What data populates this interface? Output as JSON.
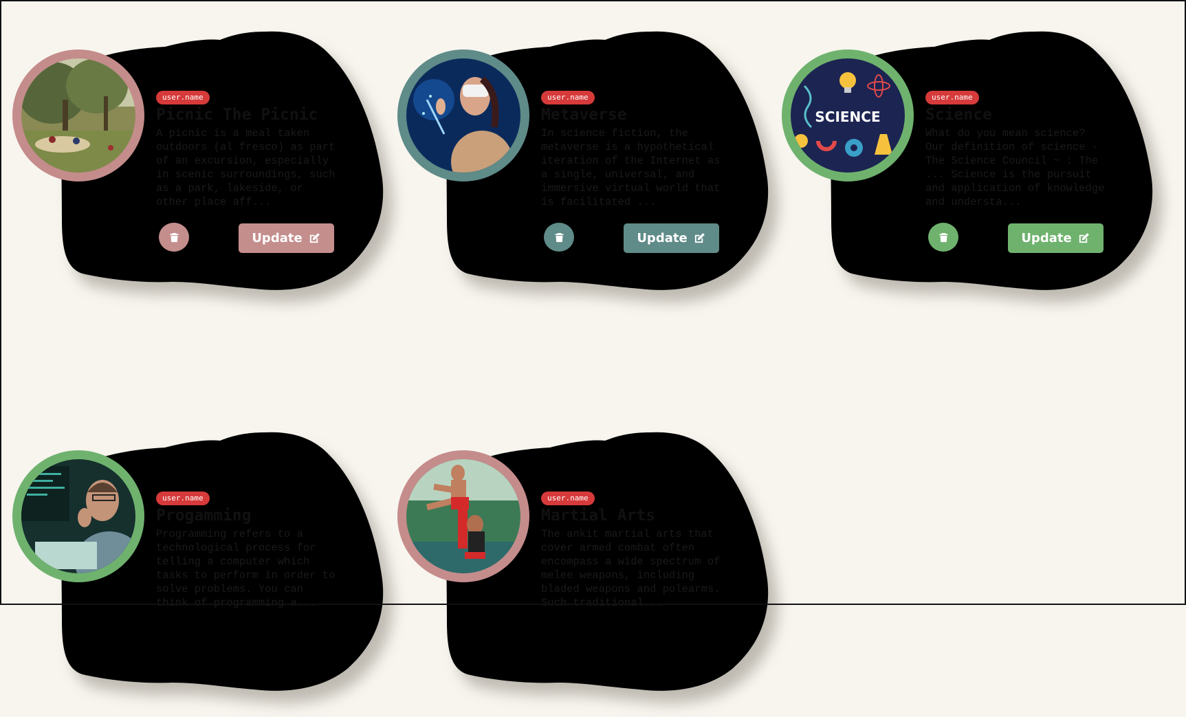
{
  "cards": [
    {
      "tag": "user.name",
      "title": "Picnic The Picnic",
      "description": "A picnic is a meal taken\noutdoors (al fresco) as part\nof an excursion, especially\nin scenic surroundings, such\nas a park, lakeside, or\nother place aff...",
      "update_label": "Update",
      "image_alt": "picnic painting",
      "theme": "pink"
    },
    {
      "tag": "user.name",
      "title": "Metaverse",
      "description": "In science fiction, the\nmetaverse is a hypothetical\niteration of the Internet as\na single, universal, and\nimmersive virtual world that\nis facilitated ...",
      "update_label": "Update",
      "image_alt": "woman with vr headset",
      "theme": "teal"
    },
    {
      "tag": "user.name",
      "title": "Science",
      "description": "What do you mean science?\nOur definition of science -\nThe Science Council ~ : The\n... Science is the pursuit\nand application of knowledge\nand understa...",
      "update_label": "Update",
      "image_alt": "science illustration",
      "image_text": "SCIENCE",
      "theme": "green"
    },
    {
      "tag": "user.name",
      "title": "Progamming",
      "description": "Programming refers to a\ntechnological process for\ntelling a computer which\ntasks to perform in order to\nsolve problems. You can\nthink of programming a...",
      "update_label": "Update",
      "image_alt": "programmer at desk",
      "theme": "green"
    },
    {
      "tag": "user.name",
      "title": "Martial Arts",
      "description": "The ankit martial arts that\ncover armed combat often\nencompass a wide spectrum of\nmelee weapons, including\nbladed weapons and polearms.\nSuch traditional...",
      "update_label": "Update",
      "image_alt": "martial arts performers",
      "theme": "pink"
    }
  ],
  "colors": {
    "background": "#f7f5ee",
    "pink_blob": "#e9b9b8",
    "pink_accent": "#c48e8d",
    "teal_blob": "#9bc5ba",
    "teal_accent": "#5f8b88",
    "green_blob": "#99c498",
    "green_accent": "#6fb26e",
    "tag_red": "#d63a3a"
  },
  "icons": {
    "delete": "trash-icon",
    "update": "edit-icon"
  }
}
